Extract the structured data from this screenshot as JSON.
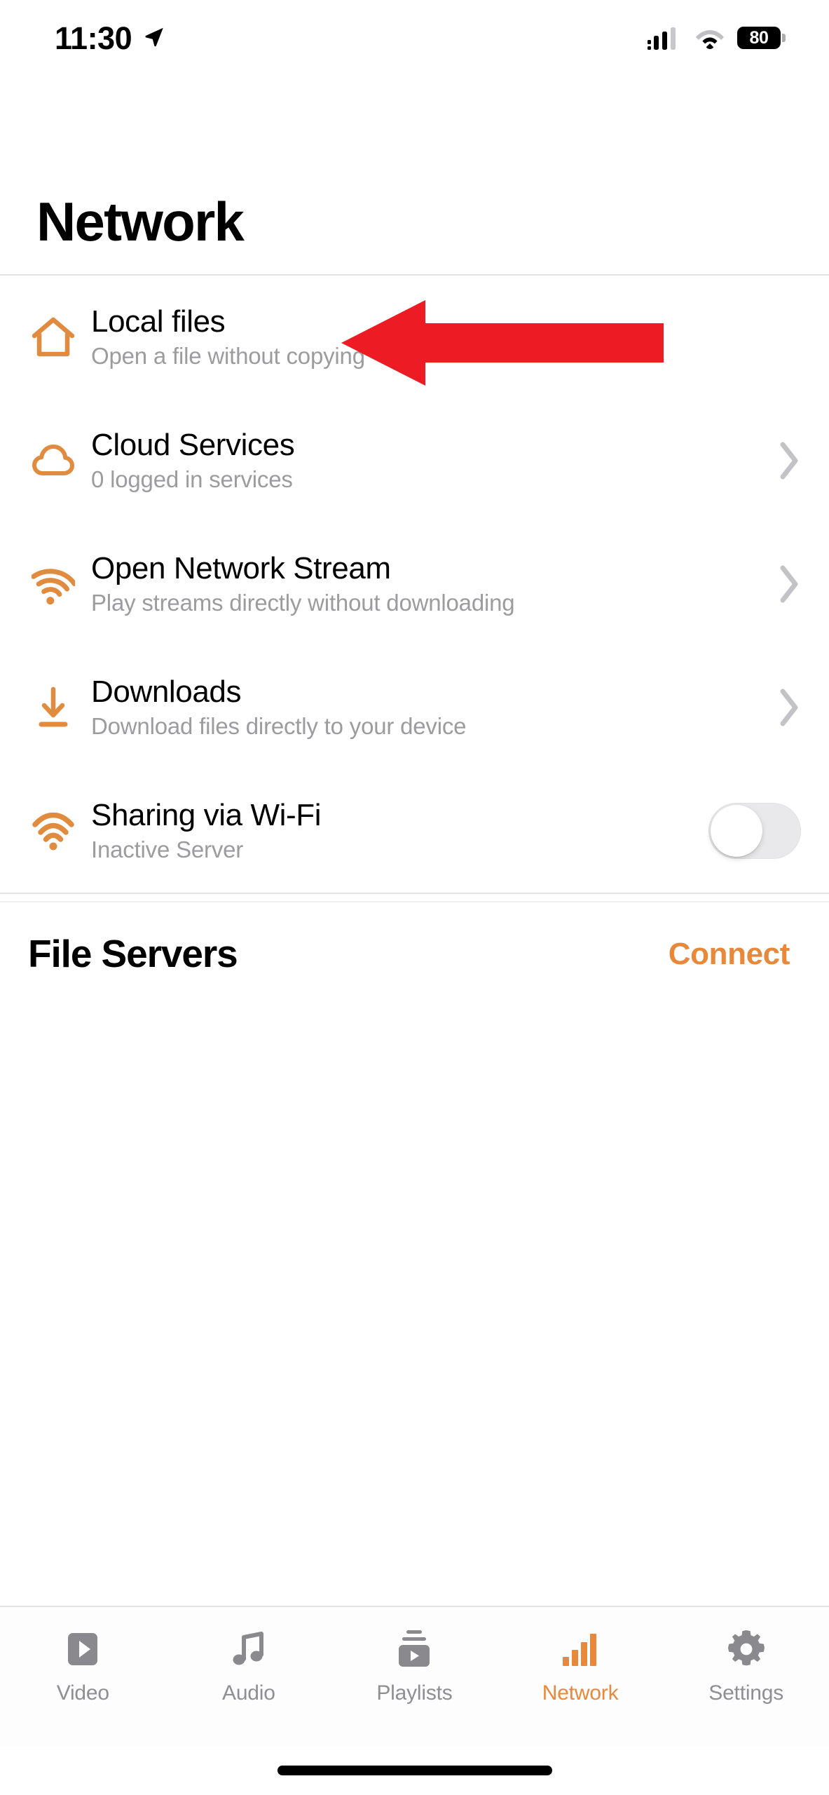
{
  "status_bar": {
    "time": "11:30",
    "location_icon": "location-arrow-icon",
    "cellular_icon": "cellular-signal-icon",
    "wifi_icon": "wifi-icon",
    "battery_level": "80",
    "battery_icon": "battery-icon"
  },
  "header": {
    "title": "Network"
  },
  "list": {
    "items": [
      {
        "id": "local-files",
        "icon": "home-icon",
        "title": "Local files",
        "subtitle": "Open a file without copying",
        "accessory": "none"
      },
      {
        "id": "cloud-services",
        "icon": "cloud-icon",
        "title": "Cloud Services",
        "subtitle": "0 logged in services",
        "accessory": "chevron-right-icon"
      },
      {
        "id": "open-network-stream",
        "icon": "rss-stream-icon",
        "title": "Open Network Stream",
        "subtitle": "Play streams directly without downloading",
        "accessory": "chevron-right-icon"
      },
      {
        "id": "downloads",
        "icon": "download-icon",
        "title": "Downloads",
        "subtitle": "Download files directly to your device",
        "accessory": "chevron-right-icon"
      },
      {
        "id": "sharing-via-wifi",
        "icon": "wifi-sharing-icon",
        "title": "Sharing via Wi-Fi",
        "subtitle": "Inactive Server",
        "accessory": "toggle",
        "toggle_state": "off"
      }
    ]
  },
  "file_servers": {
    "title": "File Servers",
    "connect_label": "Connect"
  },
  "tab_bar": {
    "tabs": [
      {
        "id": "video",
        "label": "Video",
        "icon": "video-play-icon",
        "active": false
      },
      {
        "id": "audio",
        "label": "Audio",
        "icon": "music-note-icon",
        "active": false
      },
      {
        "id": "playlists",
        "label": "Playlists",
        "icon": "playlist-icon",
        "active": false
      },
      {
        "id": "network",
        "label": "Network",
        "icon": "signal-bars-icon",
        "active": true
      },
      {
        "id": "settings",
        "label": "Settings",
        "icon": "gear-icon",
        "active": false
      }
    ]
  },
  "annotation": {
    "red_arrow": "red-arrow-pointing-left-at-local-files"
  },
  "colors": {
    "accent_orange": "#E8883A",
    "inactive_gray": "#8E8E93",
    "subtitle_gray": "#9C9C9E",
    "separator": "#E3E3E5",
    "annotation_red": "#ED1C24"
  }
}
